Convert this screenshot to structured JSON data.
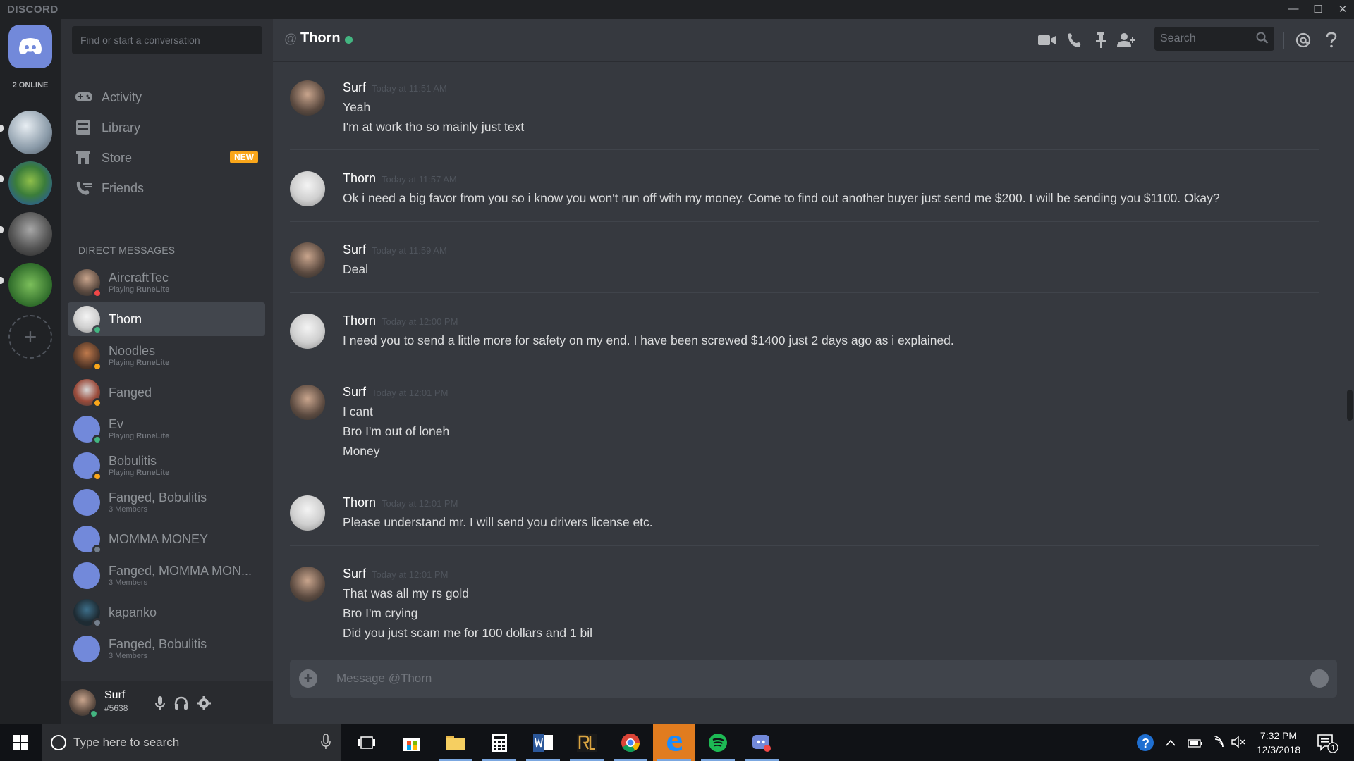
{
  "window": {
    "brand": "DISCORD",
    "controls": {
      "minimize": "—",
      "maximize": "☐",
      "close": "✕"
    }
  },
  "guilds": {
    "online_count": "2 ONLINE",
    "add_label": "+"
  },
  "sidebar": {
    "search_placeholder": "Find or start a conversation",
    "nav": [
      {
        "label": "Activity",
        "icon": "gamepad-icon"
      },
      {
        "label": "Library",
        "icon": "library-icon"
      },
      {
        "label": "Store",
        "icon": "store-icon",
        "badge": "NEW"
      },
      {
        "label": "Friends",
        "icon": "friends-icon"
      }
    ],
    "dm_header": "DIRECT MESSAGES",
    "dms": [
      {
        "name": "AircraftTec",
        "sub_prefix": "Playing ",
        "sub_game": "RuneLite",
        "status": "dnd",
        "selected": false
      },
      {
        "name": "Thorn",
        "sub_prefix": "",
        "sub_game": "",
        "status": "online",
        "selected": true
      },
      {
        "name": "Noodles",
        "sub_prefix": "Playing ",
        "sub_game": "RuneLite",
        "status": "idle",
        "selected": false
      },
      {
        "name": "Fanged",
        "sub_prefix": "",
        "sub_game": "",
        "status": "idle",
        "selected": false
      },
      {
        "name": "Ev",
        "sub_prefix": "Playing ",
        "sub_game": "RuneLite",
        "status": "online",
        "selected": false
      },
      {
        "name": "Bobulitis",
        "sub_prefix": "Playing ",
        "sub_game": "RuneLite",
        "status": "idle",
        "selected": false
      },
      {
        "name": "Fanged, Bobulitis",
        "sub_prefix": "3 Members",
        "sub_game": "",
        "status": "",
        "selected": false
      },
      {
        "name": "MOMMA MONEY",
        "sub_prefix": "",
        "sub_game": "",
        "status": "offline",
        "selected": false
      },
      {
        "name": "Fanged, MOMMA MON...",
        "sub_prefix": "3 Members",
        "sub_game": "",
        "status": "",
        "selected": false
      },
      {
        "name": "kapanko",
        "sub_prefix": "",
        "sub_game": "",
        "status": "offline",
        "selected": false
      },
      {
        "name": "Fanged, Bobulitis",
        "sub_prefix": "3 Members",
        "sub_game": "",
        "status": "",
        "selected": false
      }
    ]
  },
  "user": {
    "name": "Surf",
    "tag": "#5638"
  },
  "chat": {
    "at": "@",
    "title": "Thorn",
    "search_placeholder": "Search",
    "composer_placeholder": "Message @Thorn",
    "messages": [
      {
        "author": "Surf",
        "time": "Today at 11:51 AM",
        "lines": [
          "Yeah",
          "I'm at work tho so mainly just text"
        ]
      },
      {
        "author": "Thorn",
        "time": "Today at 11:57 AM",
        "lines": [
          "Ok i need a big favor from you so i know you won't run off with my money. Come to find out another buyer just send me $200. I will be sending you $1100. Okay?"
        ]
      },
      {
        "author": "Surf",
        "time": "Today at 11:59 AM",
        "lines": [
          "Deal"
        ]
      },
      {
        "author": "Thorn",
        "time": "Today at 12:00 PM",
        "lines": [
          "I need you to send a little more for safety on my end. I have been screwed $1400 just 2 days ago as i explained."
        ]
      },
      {
        "author": "Surf",
        "time": "Today at 12:01 PM",
        "lines": [
          "I cant",
          "Bro I'm out of loneh",
          "Money"
        ]
      },
      {
        "author": "Thorn",
        "time": "Today at 12:01 PM",
        "lines": [
          "Please understand mr. I will send you drivers license etc."
        ]
      },
      {
        "author": "Surf",
        "time": "Today at 12:01 PM",
        "lines": [
          "That was all my rs gold",
          "Bro I'm crying",
          "Did you just scam me for 100 dollars and 1 bil"
        ]
      }
    ]
  },
  "taskbar": {
    "search_placeholder": "Type here to search",
    "apps": [
      "task-view",
      "store",
      "file-explorer",
      "calculator",
      "word",
      "runelite",
      "chrome",
      "edge",
      "spotify",
      "discord"
    ],
    "clock_time": "7:32 PM",
    "clock_date": "12/3/2018",
    "notification_count": "1"
  },
  "colors": {
    "blurple": "#7289da",
    "online": "#43b581",
    "idle": "#faa61a",
    "dnd": "#f04747",
    "offline": "#747f8d",
    "bg_main": "#36393f",
    "bg_sidebar": "#2f3136",
    "bg_guilds": "#202225"
  }
}
